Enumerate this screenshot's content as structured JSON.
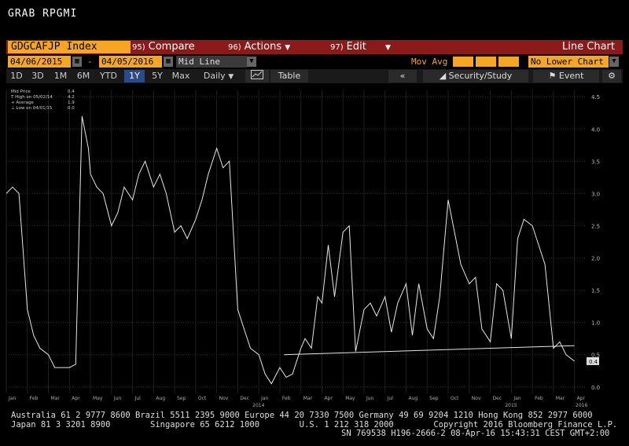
{
  "window": {
    "title": "GRAB RPGMI"
  },
  "command_bar": {
    "ticker": "GDGCAFJP Index",
    "compare": {
      "num": "95)",
      "label": "Compare"
    },
    "actions": {
      "num": "96)",
      "label": "Actions"
    },
    "edit": {
      "num": "97)",
      "label": "Edit"
    },
    "chart_type": "Line Chart"
  },
  "date_bar": {
    "start_date": "04/06/2015",
    "end_date": "04/05/2016",
    "field": "Mid Line",
    "mov_avg_label": "Mov Avg",
    "lower_chart": "No Lower Chart"
  },
  "range_bar": {
    "ranges": [
      "1D",
      "3D",
      "1M",
      "6M",
      "YTD",
      "1Y",
      "5Y",
      "Max"
    ],
    "active": "1Y",
    "period": "Daily",
    "table_label": "Table",
    "security_study": "Security/Study",
    "event": "Event"
  },
  "legend": {
    "rows": [
      {
        "label": "Mid Price",
        "value": "0.4"
      },
      {
        "label": "T High on 05/02/14",
        "value": "4.2"
      },
      {
        "label": "+ Average",
        "value": "1.9"
      },
      {
        "label": "⊥ Low on 04/01/15",
        "value": "0.0"
      }
    ]
  },
  "footer": {
    "line1": "Australia 61 2 9777 8600 Brazil 5511 2395 9000 Europe 44 20 7330 7500 Germany 49 69 9204 1210 Hong Kong 852 2977 6000",
    "line2": "Japan 81 3 3201 8900        Singapore 65 6212 1000        U.S. 1 212 318 2000        Copyright 2016 Bloomberg Finance L.P.",
    "line3": "SN 769538 H196-2666-2 08-Apr-16 15:43:31 CEST GMT+2:00"
  },
  "colors": {
    "accent": "#f5a623",
    "command_bar": "#8b1a1a",
    "line": "#e6e6e6"
  },
  "chart_data": {
    "type": "line",
    "title": "",
    "xlabel": "",
    "ylabel": "",
    "ylim": [
      -0.1,
      4.6
    ],
    "y_ticks": [
      "0.0",
      "0.5",
      "1.0",
      "1.5",
      "2.0",
      "2.5",
      "3.0",
      "3.5",
      "4.0",
      "4.5"
    ],
    "x_ticks": [
      "Jan",
      "Feb",
      "Mar",
      "Apr",
      "May",
      "Jun",
      "Jul",
      "Aug",
      "Sep",
      "Oct",
      "Nov",
      "Dec",
      "Jan",
      "Feb",
      "Mar",
      "Apr",
      "May",
      "Jun",
      "Jul",
      "Aug",
      "Sep",
      "Oct",
      "Nov",
      "Dec",
      "Jan",
      "Feb",
      "Mar",
      "Apr"
    ],
    "year_labels": [
      {
        "label": "2014",
        "month_index": 12
      },
      {
        "label": "2015",
        "month_index": 24
      },
      {
        "label": "2016",
        "month_index": 36
      }
    ],
    "last_value": "0.4",
    "series": [
      {
        "x": [
          0,
          0.3,
          0.6,
          1,
          1.3,
          1.6,
          2,
          2.3,
          2.6,
          3,
          3.3,
          3.6,
          3.9,
          4,
          4.3,
          4.6,
          5,
          5.3,
          5.6,
          6,
          6.3,
          6.6,
          7,
          7.3,
          7.6,
          8,
          8.3,
          8.6,
          9,
          9.3,
          9.6,
          10,
          10.3,
          10.6,
          11,
          11.3,
          11.6,
          12,
          12.3,
          12.6,
          13,
          13.3,
          13.6,
          14,
          14.2,
          14.5,
          14.8,
          15,
          15.3,
          15.6,
          16,
          16.3,
          16.6,
          17,
          17.3,
          17.6,
          18,
          18.3,
          18.6,
          19,
          19.3,
          19.6,
          20,
          20.3,
          20.6,
          21,
          21.3,
          21.6,
          22,
          22.3,
          22.6,
          23,
          23.3,
          23.6,
          24,
          24.3,
          24.6,
          25,
          25.3,
          25.6,
          26,
          26.3,
          26.6,
          27
        ],
        "y": [
          3.0,
          3.1,
          3.0,
          1.2,
          0.8,
          0.6,
          0.5,
          0.3,
          0.3,
          0.3,
          0.35,
          4.2,
          3.7,
          3.3,
          3.1,
          3.0,
          2.5,
          2.7,
          3.1,
          2.9,
          3.3,
          3.5,
          3.1,
          3.3,
          3.0,
          2.4,
          2.5,
          2.3,
          2.6,
          2.9,
          3.3,
          3.7,
          3.4,
          3.5,
          1.2,
          0.9,
          0.6,
          0.5,
          0.2,
          0.05,
          0.3,
          0.15,
          0.2,
          0.6,
          0.75,
          0.6,
          1.4,
          1.3,
          2.2,
          1.4,
          2.4,
          2.5,
          0.55,
          1.2,
          1.3,
          1.1,
          1.4,
          0.85,
          1.3,
          1.6,
          0.8,
          1.6,
          0.9,
          0.75,
          1.4,
          2.9,
          2.4,
          1.9,
          1.6,
          1.7,
          0.9,
          0.7,
          1.6,
          1.5,
          0.75,
          2.3,
          2.6,
          2.5,
          2.2,
          1.9,
          0.6,
          0.7,
          0.5,
          0.4
        ]
      },
      {
        "x": [
          13.2,
          27
        ],
        "y": [
          0.5,
          0.64
        ]
      }
    ]
  }
}
